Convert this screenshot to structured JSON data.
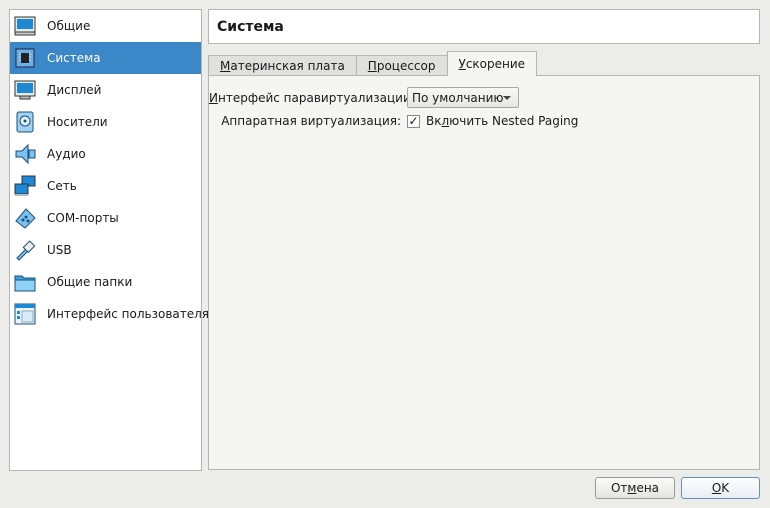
{
  "sidebar": {
    "items": [
      {
        "label": "Общие",
        "icon": "general-monitor-icon"
      },
      {
        "label": "Система",
        "icon": "system-chip-icon",
        "selected": true
      },
      {
        "label": "Дисплей",
        "icon": "display-monitor-icon"
      },
      {
        "label": "Носители",
        "icon": "storage-disk-icon"
      },
      {
        "label": "Аудио",
        "icon": "audio-speaker-icon"
      },
      {
        "label": "Сеть",
        "icon": "network-icon"
      },
      {
        "label": "COM-порты",
        "icon": "serial-port-icon"
      },
      {
        "label": "USB",
        "icon": "usb-icon"
      },
      {
        "label": "Общие папки",
        "icon": "shared-folder-icon"
      },
      {
        "label": "Интерфейс пользователя",
        "icon": "user-interface-icon"
      }
    ]
  },
  "page_title": "Система",
  "tabs": [
    {
      "pre": "",
      "accel": "М",
      "post": "атеринская плата"
    },
    {
      "pre": "",
      "accel": "П",
      "post": "роцессор"
    },
    {
      "pre": "",
      "accel": "У",
      "post": "скорение",
      "active": true
    }
  ],
  "acceleration": {
    "paravirt_label_accel": "И",
    "paravirt_label_rest": "нтерфейс паравиртуализации:",
    "paravirt_value": "По умолчанию",
    "hwvirt_label": "Аппаратная виртуализация:",
    "nested_paging_pre": "Вк",
    "nested_paging_accel": "л",
    "nested_paging_post": "ючить Nested Paging",
    "nested_paging_checked": "✓"
  },
  "buttons": {
    "cancel_pre": "От",
    "cancel_accel": "м",
    "cancel_post": "ена",
    "ok_accel": "O",
    "ok_post": "K"
  },
  "colors": {
    "selection": "#3b87c8",
    "window_bg": "#ececeb"
  }
}
